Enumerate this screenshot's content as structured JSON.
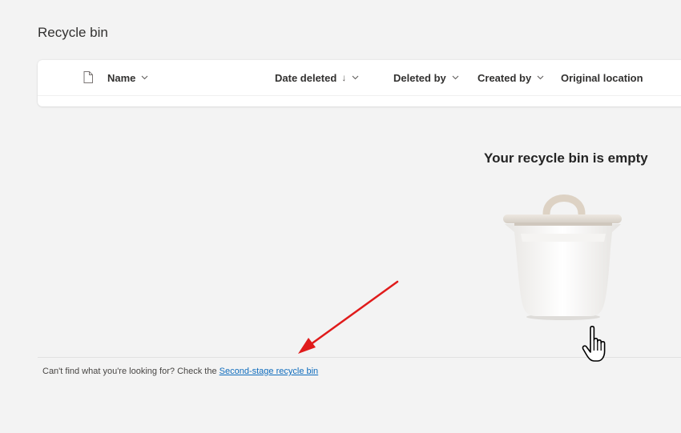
{
  "page": {
    "title": "Recycle bin"
  },
  "table": {
    "columns": [
      {
        "label": "Name",
        "has_menu": true
      },
      {
        "label": "Date deleted",
        "sort_indicator": "↓",
        "has_menu": true
      },
      {
        "label": "Deleted by",
        "has_menu": true
      },
      {
        "label": "Created by",
        "has_menu": true
      },
      {
        "label": "Original location",
        "has_menu": false
      }
    ],
    "header_icon": "file-icon",
    "rows": []
  },
  "empty_state": {
    "title": "Your recycle bin is empty",
    "illustration": "recycle-bin-icon"
  },
  "footer": {
    "text": "Can't find what you're looking for? Check the ",
    "link_label": "Second-stage recycle bin"
  },
  "overlays": {
    "annotation": "red-arrow-icon",
    "cursor": "hand-pointer-icon"
  },
  "colors": {
    "background": "#f3f3f3",
    "card": "#ffffff",
    "link": "#0f6cbd",
    "arrow": "#e01b1b"
  }
}
